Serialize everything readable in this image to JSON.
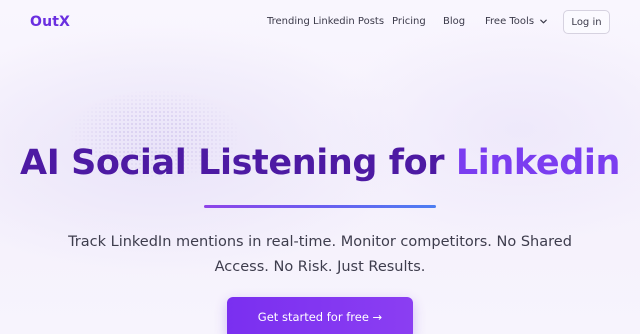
{
  "nav": {
    "logo": "OutX",
    "links": [
      {
        "label": "Trending Linkedin Posts"
      },
      {
        "label": "Pricing"
      },
      {
        "label": "Blog"
      },
      {
        "label": "Free Tools"
      }
    ],
    "login_label": "Log in"
  },
  "hero": {
    "title_part1": "AI Social Listening for ",
    "title_part2": "Linkedin",
    "subtitle": "Track LinkedIn mentions in real-time. Monitor competitors. No Shared Access. No Risk. Just Results.",
    "cta_label": "Get started for free →"
  },
  "colors": {
    "brand": "#6a2fe0",
    "title": "#4d1aa3",
    "accent": "#7b3df0",
    "cta": "#7a2ff0"
  },
  "icons": {
    "free_tools_dropdown": "chevron-down-icon"
  }
}
